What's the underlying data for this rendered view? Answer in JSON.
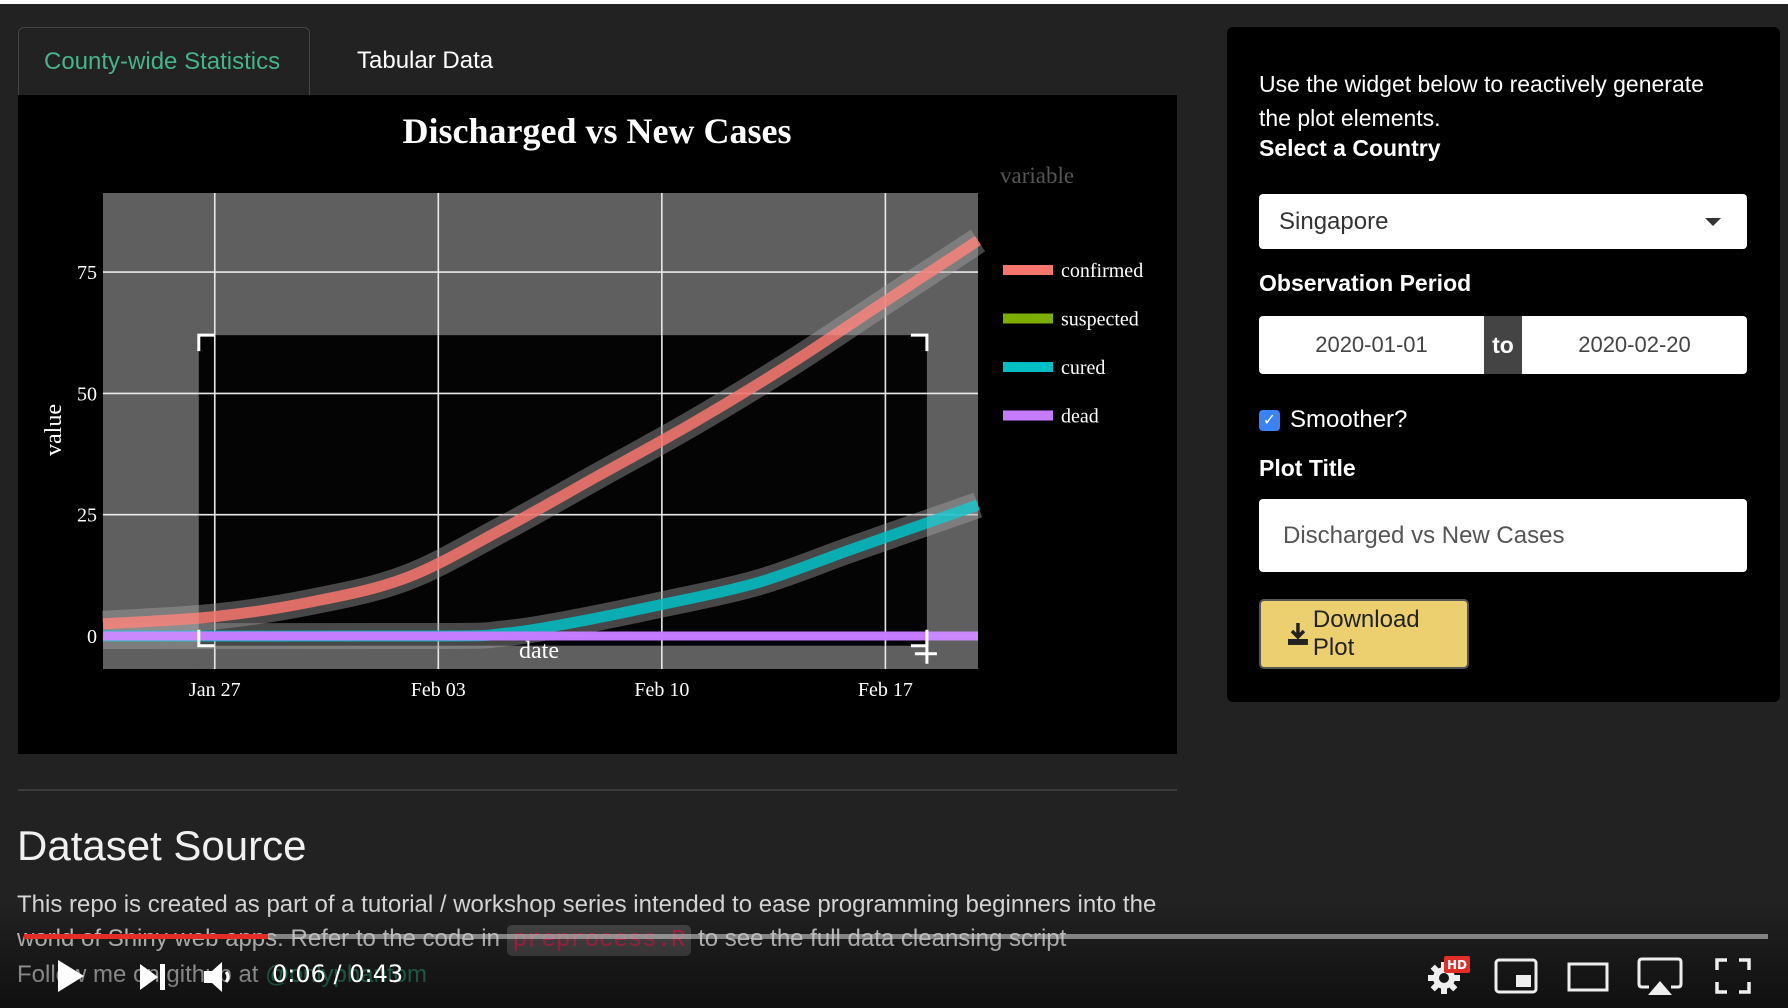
{
  "tabs": [
    {
      "label": "County-wide Statistics",
      "active": true
    },
    {
      "label": "Tabular Data",
      "active": false
    }
  ],
  "chart_data": {
    "type": "line",
    "title": "Discharged vs New Cases",
    "xlabel": "date",
    "ylabel": "value",
    "legend_title": "variable",
    "legend_position": "right",
    "x_ticks": [
      "Jan 27",
      "Feb 03",
      "Feb 10",
      "Feb 17"
    ],
    "x_tick_days": [
      26,
      33,
      40,
      47
    ],
    "x_range_days": [
      22.5,
      49.9
    ],
    "y_ticks": [
      0,
      25,
      50,
      75
    ],
    "ylim": [
      -6.8,
      91.3
    ],
    "grid": true,
    "smoothed_with_confidence_band": true,
    "x_days_note": "days since 2020-01-01",
    "series": [
      {
        "name": "confirmed",
        "color": "#f8766d",
        "x": [
          22.5,
          26,
          29,
          32,
          35,
          38,
          41,
          44,
          47,
          49.9
        ],
        "y": [
          2.5,
          4,
          7,
          12,
          22,
          33,
          44,
          56,
          69,
          81.5
        ]
      },
      {
        "name": "suspected",
        "color": "#7cae00",
        "x": [
          22.5,
          49.9
        ],
        "y": [
          0,
          0
        ]
      },
      {
        "name": "cured",
        "color": "#00bfc4",
        "x": [
          22.5,
          33,
          35,
          37,
          40,
          43,
          46,
          49.9
        ],
        "y": [
          0,
          0,
          0.5,
          2.5,
          6.5,
          11,
          18,
          27
        ]
      },
      {
        "name": "dead",
        "color": "#c77cff",
        "x": [
          22.5,
          49.9
        ],
        "y": [
          0,
          0
        ]
      }
    ],
    "selection_box_days": [
      25.5,
      48.3
    ],
    "selection_box_values": [
      -2,
      62
    ]
  },
  "main": {
    "section_title": "Dataset Source",
    "paragraph_part1": "This repo is created as part of a tutorial / workshop series intended to ease programming beginners into the world of Shiny web apps. Refer to the code in ",
    "code_file": "preprocess.R",
    "paragraph_part2": " to see the full data cleansing script",
    "follow_text": "Follow me on github at ",
    "follow_link": "@onlyphantom"
  },
  "sidebar": {
    "intro": "Use the widget below to reactively generate the plot elements.",
    "country_label": "Select a Country",
    "country_value": "Singapore",
    "period_label": "Observation Period",
    "date_start": "2020-01-01",
    "date_sep": "to",
    "date_end": "2020-02-20",
    "smoother_label": "Smoother?",
    "smoother_checked": true,
    "plot_title_label": "Plot Title",
    "plot_title_value": "Discharged vs New Cases",
    "download_label": "Download Plot"
  },
  "video": {
    "current_time": "0:06",
    "duration": "0:43",
    "time_display": "0:06 / 0:43",
    "progress_fraction": 0.14,
    "quality_badge": "HD",
    "progress_color": "#e52d27"
  }
}
